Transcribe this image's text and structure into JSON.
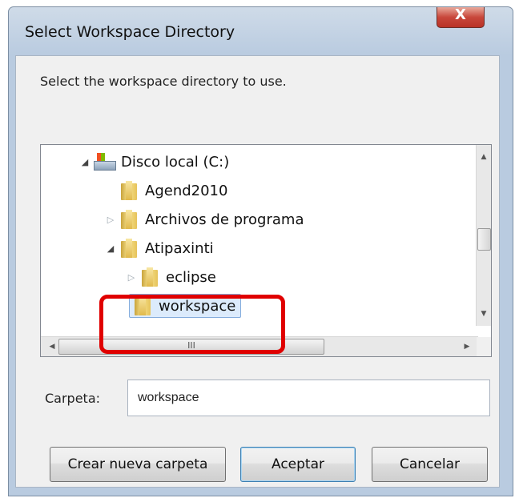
{
  "dialog": {
    "title": "Select Workspace Directory",
    "close_glyph": "X",
    "message": "Select the workspace directory to use."
  },
  "tree": {
    "items": [
      {
        "label": "Disco local (C:)",
        "icon": "drive-icon"
      },
      {
        "label": "Agend2010",
        "icon": "folder-icon"
      },
      {
        "label": "Archivos de programa",
        "icon": "folder-icon"
      },
      {
        "label": "Atipaxinti",
        "icon": "folder-icon"
      },
      {
        "label": "eclipse",
        "icon": "folder-icon"
      },
      {
        "label": "workspace",
        "icon": "folder-icon",
        "selected": true
      }
    ],
    "hscroll_grip": "III"
  },
  "folder_field": {
    "label": "Carpeta:",
    "value": "workspace"
  },
  "buttons": {
    "new_folder": "Crear nueva carpeta",
    "accept": "Aceptar",
    "cancel": "Cancelar"
  },
  "colors": {
    "highlight": "#e00000",
    "selection": "#dcebfc"
  }
}
